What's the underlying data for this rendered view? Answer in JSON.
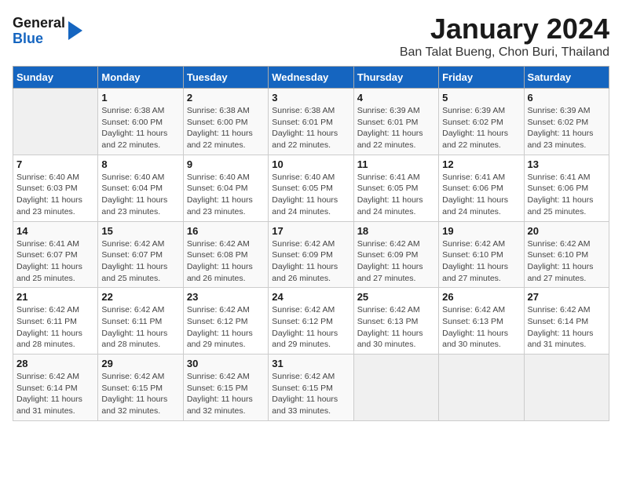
{
  "header": {
    "logo_general": "General",
    "logo_blue": "Blue",
    "title": "January 2024",
    "subtitle": "Ban Talat Bueng, Chon Buri, Thailand"
  },
  "calendar": {
    "days_of_week": [
      "Sunday",
      "Monday",
      "Tuesday",
      "Wednesday",
      "Thursday",
      "Friday",
      "Saturday"
    ],
    "weeks": [
      [
        {
          "day": "",
          "info": ""
        },
        {
          "day": "1",
          "info": "Sunrise: 6:38 AM\nSunset: 6:00 PM\nDaylight: 11 hours and 22 minutes."
        },
        {
          "day": "2",
          "info": "Sunrise: 6:38 AM\nSunset: 6:00 PM\nDaylight: 11 hours and 22 minutes."
        },
        {
          "day": "3",
          "info": "Sunrise: 6:38 AM\nSunset: 6:01 PM\nDaylight: 11 hours and 22 minutes."
        },
        {
          "day": "4",
          "info": "Sunrise: 6:39 AM\nSunset: 6:01 PM\nDaylight: 11 hours and 22 minutes."
        },
        {
          "day": "5",
          "info": "Sunrise: 6:39 AM\nSunset: 6:02 PM\nDaylight: 11 hours and 22 minutes."
        },
        {
          "day": "6",
          "info": "Sunrise: 6:39 AM\nSunset: 6:02 PM\nDaylight: 11 hours and 23 minutes."
        }
      ],
      [
        {
          "day": "7",
          "info": "Sunrise: 6:40 AM\nSunset: 6:03 PM\nDaylight: 11 hours and 23 minutes."
        },
        {
          "day": "8",
          "info": "Sunrise: 6:40 AM\nSunset: 6:04 PM\nDaylight: 11 hours and 23 minutes."
        },
        {
          "day": "9",
          "info": "Sunrise: 6:40 AM\nSunset: 6:04 PM\nDaylight: 11 hours and 23 minutes."
        },
        {
          "day": "10",
          "info": "Sunrise: 6:40 AM\nSunset: 6:05 PM\nDaylight: 11 hours and 24 minutes."
        },
        {
          "day": "11",
          "info": "Sunrise: 6:41 AM\nSunset: 6:05 PM\nDaylight: 11 hours and 24 minutes."
        },
        {
          "day": "12",
          "info": "Sunrise: 6:41 AM\nSunset: 6:06 PM\nDaylight: 11 hours and 24 minutes."
        },
        {
          "day": "13",
          "info": "Sunrise: 6:41 AM\nSunset: 6:06 PM\nDaylight: 11 hours and 25 minutes."
        }
      ],
      [
        {
          "day": "14",
          "info": "Sunrise: 6:41 AM\nSunset: 6:07 PM\nDaylight: 11 hours and 25 minutes."
        },
        {
          "day": "15",
          "info": "Sunrise: 6:42 AM\nSunset: 6:07 PM\nDaylight: 11 hours and 25 minutes."
        },
        {
          "day": "16",
          "info": "Sunrise: 6:42 AM\nSunset: 6:08 PM\nDaylight: 11 hours and 26 minutes."
        },
        {
          "day": "17",
          "info": "Sunrise: 6:42 AM\nSunset: 6:09 PM\nDaylight: 11 hours and 26 minutes."
        },
        {
          "day": "18",
          "info": "Sunrise: 6:42 AM\nSunset: 6:09 PM\nDaylight: 11 hours and 27 minutes."
        },
        {
          "day": "19",
          "info": "Sunrise: 6:42 AM\nSunset: 6:10 PM\nDaylight: 11 hours and 27 minutes."
        },
        {
          "day": "20",
          "info": "Sunrise: 6:42 AM\nSunset: 6:10 PM\nDaylight: 11 hours and 27 minutes."
        }
      ],
      [
        {
          "day": "21",
          "info": "Sunrise: 6:42 AM\nSunset: 6:11 PM\nDaylight: 11 hours and 28 minutes."
        },
        {
          "day": "22",
          "info": "Sunrise: 6:42 AM\nSunset: 6:11 PM\nDaylight: 11 hours and 28 minutes."
        },
        {
          "day": "23",
          "info": "Sunrise: 6:42 AM\nSunset: 6:12 PM\nDaylight: 11 hours and 29 minutes."
        },
        {
          "day": "24",
          "info": "Sunrise: 6:42 AM\nSunset: 6:12 PM\nDaylight: 11 hours and 29 minutes."
        },
        {
          "day": "25",
          "info": "Sunrise: 6:42 AM\nSunset: 6:13 PM\nDaylight: 11 hours and 30 minutes."
        },
        {
          "day": "26",
          "info": "Sunrise: 6:42 AM\nSunset: 6:13 PM\nDaylight: 11 hours and 30 minutes."
        },
        {
          "day": "27",
          "info": "Sunrise: 6:42 AM\nSunset: 6:14 PM\nDaylight: 11 hours and 31 minutes."
        }
      ],
      [
        {
          "day": "28",
          "info": "Sunrise: 6:42 AM\nSunset: 6:14 PM\nDaylight: 11 hours and 31 minutes."
        },
        {
          "day": "29",
          "info": "Sunrise: 6:42 AM\nSunset: 6:15 PM\nDaylight: 11 hours and 32 minutes."
        },
        {
          "day": "30",
          "info": "Sunrise: 6:42 AM\nSunset: 6:15 PM\nDaylight: 11 hours and 32 minutes."
        },
        {
          "day": "31",
          "info": "Sunrise: 6:42 AM\nSunset: 6:15 PM\nDaylight: 11 hours and 33 minutes."
        },
        {
          "day": "",
          "info": ""
        },
        {
          "day": "",
          "info": ""
        },
        {
          "day": "",
          "info": ""
        }
      ]
    ]
  }
}
